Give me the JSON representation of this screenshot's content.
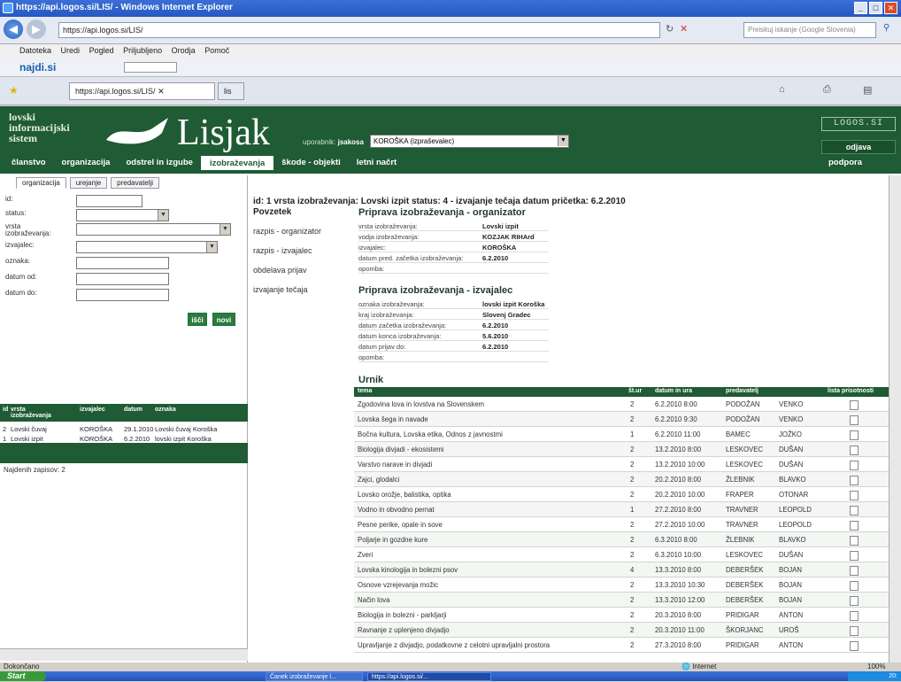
{
  "browser": {
    "title": "https://api.logos.si/LIS/ - Windows Internet Explorer",
    "url": "https://api.logos.si/LIS/",
    "search_placeholder": "Preiskuj iskanje (Google Slovenia)",
    "menu": [
      "Datoteka",
      "Uredi",
      "Pogled",
      "Priljubljeno",
      "Orodja",
      "Pomoč"
    ],
    "tab_label": "https://api.logos.si/LIS/",
    "tab2_label": "lis",
    "toolbar_brand": "najdi.si"
  },
  "app": {
    "title_small": "lovski\ninformacijski\nsistem",
    "title_big": "Lisjak",
    "user_label": "uporabnik:",
    "user_name": "jsakosa",
    "org_select": "KOROŠKA (izpraševalec)",
    "logos": "LOGOS.SI",
    "logout": "odjava",
    "support": "podpora",
    "nav": [
      "članstvo",
      "organizacija",
      "odstrel in izgube",
      "izobraževanja",
      "škode - objekti",
      "letni načrt"
    ],
    "nav_active_index": 3
  },
  "left": {
    "tabs": [
      "organizacija",
      "urejanje",
      "predavatelji"
    ],
    "fields": [
      {
        "label": "id:",
        "value": ""
      },
      {
        "label": "status:",
        "value": ""
      },
      {
        "label": "vrsta izobraževanja:",
        "value": ""
      },
      {
        "label": "izvajalec:",
        "value": ""
      },
      {
        "label": "oznaka:",
        "value": ""
      },
      {
        "label": "datum od:",
        "value": ""
      },
      {
        "label": "datum do:",
        "value": ""
      }
    ],
    "btn_search": "išči",
    "btn_new": "novi",
    "list_headers": [
      "id",
      "vrsta izobraževanja",
      "izvajalec",
      "datum",
      "oznaka"
    ],
    "rows": [
      [
        "2",
        "Lovski čuvaj",
        "KOROŠKA",
        "29.1.2010",
        "Lovski čuvaj Koroška"
      ],
      [
        "1",
        "Lovski izpit",
        "KOROŠKA",
        "6.2.2010",
        "lovski izpit Koroška"
      ]
    ],
    "count": "Najdenih zapisov: 2"
  },
  "middle": {
    "heading": "Povzetek",
    "links": [
      "razpis - organizator",
      "razpis - izvajalec",
      "obdelava prijav",
      "izvajanje tečaja"
    ]
  },
  "detail": {
    "id_line": "id: 1  vrsta izobraževanja: Lovski izpit  status: 4 - izvajanje tečaja  datum pričetka: 6.2.2010",
    "org_title": "Priprava izobraževanja - organizator",
    "org_rows": [
      {
        "k": "vrsta izobraževanja:",
        "v": "Lovski izpit"
      },
      {
        "k": "vodja izobraževanja:",
        "v": "KOZJAK RIHArd"
      },
      {
        "k": "izvajalec:",
        "v": "KOROŠKA"
      },
      {
        "k": "datum pred. začetka izobraževanja:",
        "v": "6.2.2010"
      },
      {
        "k": "opomba:",
        "v": ""
      }
    ],
    "izv_title": "Priprava izobraževanja - izvajalec",
    "izv_rows": [
      {
        "k": "oznaka izobraževanja:",
        "v": "lovski izpit Koroška"
      },
      {
        "k": "kraj izobraževanja:",
        "v": "Slovenj Gradec"
      },
      {
        "k": "datum začetka izobraževanja:",
        "v": "6.2.2010"
      },
      {
        "k": "datum konca izobraževanja:",
        "v": "5.6.2010"
      },
      {
        "k": "datum prijav do:",
        "v": "6.2.2010"
      },
      {
        "k": "opomba:",
        "v": ""
      }
    ],
    "urnik_title": "Urnik",
    "table_headers": [
      "tema",
      "št.ur",
      "datum in ura",
      "predavatelj",
      "",
      "lista prisotnosti"
    ],
    "table_rows": [
      [
        "Zgodovina lova in lovstva na Slovenskem",
        "2",
        "6.2.2010 8:00",
        "PODOŽAN",
        "VENKO"
      ],
      [
        "Lovska šega in navade",
        "2",
        "6.2.2010 9:30",
        "PODOŽAN",
        "VENKO"
      ],
      [
        "Bočna kultura, Lovska etika, Odnos z javnostmi",
        "1",
        "6.2.2010 11:00",
        "BAMEC",
        "JOŽKO"
      ],
      [
        "Biologija divjadi - ekosistemi",
        "2",
        "13.2.2010 8:00",
        "LESKOVEC",
        "DUŠAN"
      ],
      [
        "Varstvo narave in divjadi",
        "2",
        "13.2.2010 10:00",
        "LESKOVEC",
        "DUŠAN"
      ],
      [
        "Zajci, glodalci",
        "2",
        "20.2.2010 8:00",
        "ŽLEBNIK",
        "BLAVKO"
      ],
      [
        "Lovsko orožje, balistika, optika",
        "2",
        "20.2.2010 10:00",
        "FRAPER",
        "OTONAR"
      ],
      [
        "Vodno in obvodno pernat",
        "1",
        "27.2.2010 8:00",
        "TRAVNER",
        "LEOPOLD"
      ],
      [
        "Pesne perike, opale in sove",
        "2",
        "27.2.2010 10:00",
        "TRAVNER",
        "LEOPOLD"
      ],
      [
        "Poljarje in gozdne kure",
        "2",
        "6.3.2010 8:00",
        "ŽLEBNIK",
        "BLAVKO"
      ],
      [
        "Zveri",
        "2",
        "6.3.2010 10:00",
        "LESKOVEC",
        "DUŠAN"
      ],
      [
        "Lovska kinologija in bolezni psov",
        "4",
        "13.3.2010 8:00",
        "DEBERŠEK",
        "BOJAN"
      ],
      [
        "Osnove vzrejevanja možic",
        "2",
        "13.3.2010 10:30",
        "DEBERŠEK",
        "BOJAN"
      ],
      [
        "Način lova",
        "2",
        "13.3.2010 12:00",
        "DEBERŠEK",
        "BOJAN"
      ],
      [
        "Biologija in bolezni - parkljarji",
        "2",
        "20.3.2010 8:00",
        "PRIDIGAR",
        "ANTON"
      ],
      [
        "Ravnanje z uplenjeno divjadjo",
        "2",
        "20.3.2010 11:00",
        "ŠKORJANC",
        "UROŠ"
      ],
      [
        "Upravljanje z divjadjo, podatkovne z celotni upravljalni prostora",
        "2",
        "27.3.2010 8:00",
        "PRIDIGAR",
        "ANTON"
      ]
    ]
  },
  "status": {
    "left": "Dokončano",
    "zone": "Internet",
    "zoom": "100%"
  },
  "taskbar": {
    "start": "Start",
    "items": [
      "Čanek izobraževanje l...",
      "https://api.logos.si/..."
    ],
    "clock": "20:"
  }
}
